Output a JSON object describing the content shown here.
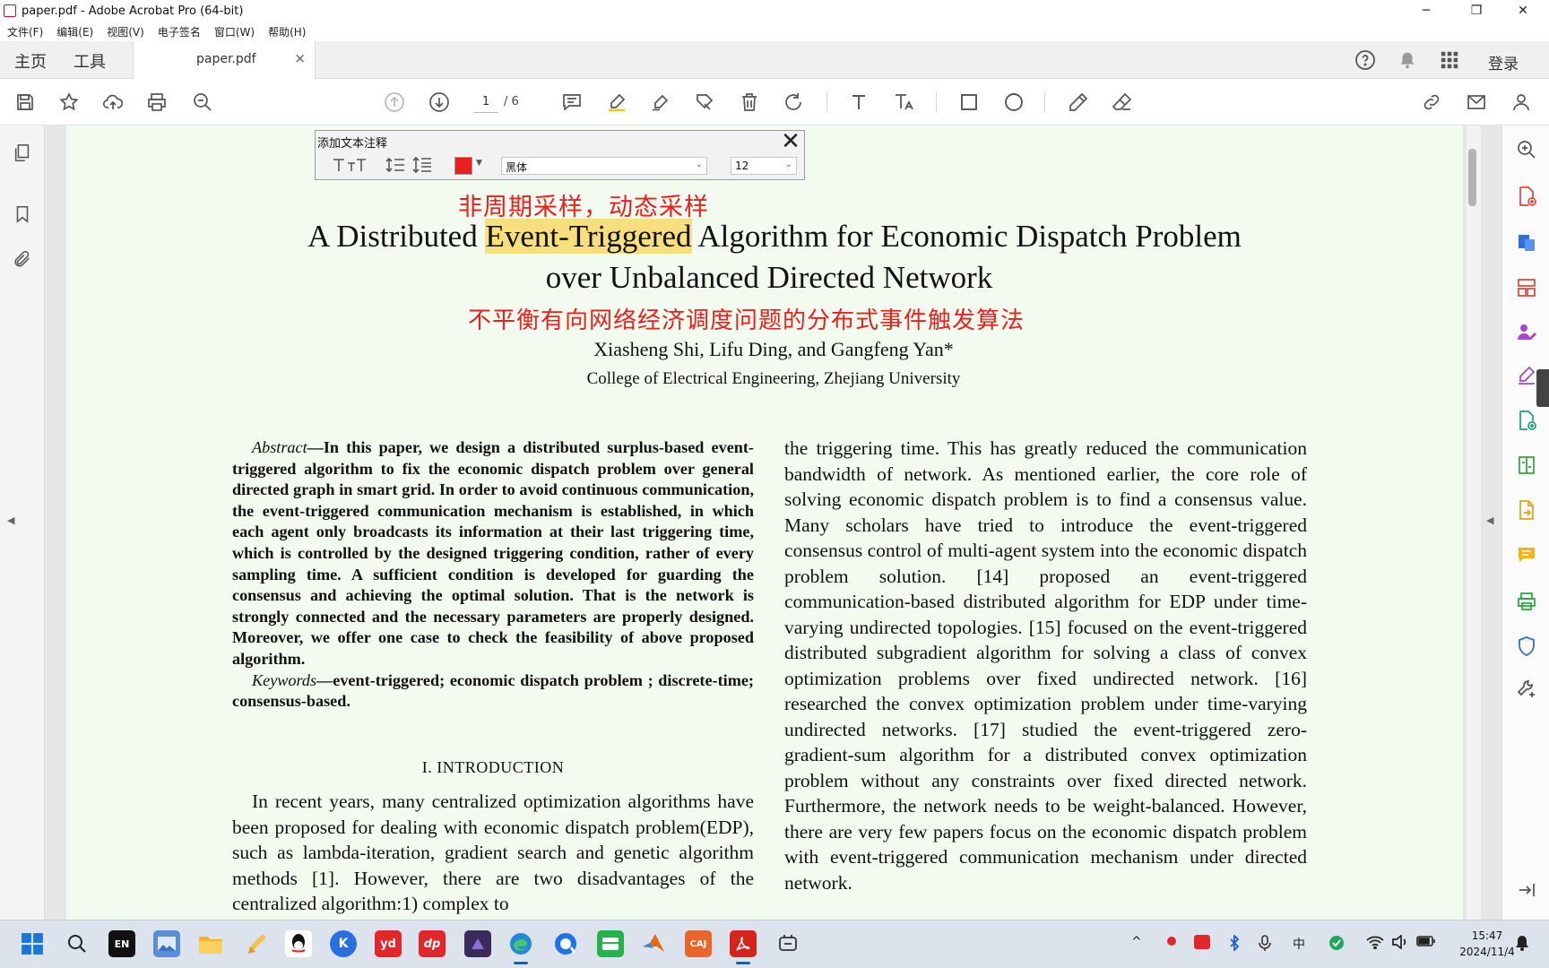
{
  "window": {
    "title": "paper.pdf - Adobe Acrobat Pro (64-bit)",
    "controls": {
      "minimize": "─",
      "restore": "❐",
      "close": "✕"
    }
  },
  "menu": [
    "文件(F)",
    "编辑(E)",
    "视图(V)",
    "电子签名",
    "窗口(W)",
    "帮助(H)"
  ],
  "tabs": {
    "home": "主页",
    "tools": "工具",
    "document": "paper.pdf",
    "close": "×",
    "login": "登录"
  },
  "toolbar": {
    "current_page": "1",
    "total_pages": "/ 6"
  },
  "annotation_toolbar": {
    "title": "添加文本注释",
    "close": "✕",
    "font": "黑体",
    "size": "12",
    "color": "#e8211c"
  },
  "paper": {
    "annotation_top": "非周期采样，动态采样",
    "title_pre": "A Distributed ",
    "title_highlight": "Event-Triggered",
    "title_post": " Algorithm for Economic Dispatch Problem",
    "title_line2": "over Unbalanced Directed Network",
    "annotation_middle": "不平衡有向网络经济调度问题的分布式事件触发算法",
    "authors": "Xiasheng Shi, Lifu Ding, and Gangfeng Yan*",
    "affiliation": "College of Electrical Engineering, Zhejiang University",
    "abstract_label": "Abstract",
    "abstract_text": "—In this paper, we design a distributed surplus-based event-triggered algorithm to fix the economic dispatch problem over general directed graph in smart grid. In order to avoid continuous communication, the event-triggered communication mechanism is established, in which each agent only broadcasts its information at their last triggering time, which is controlled by the designed triggering condition, rather of every sampling time. A sufficient condition is developed for guarding the consensus and achieving the optimal solution. That is the network is strongly connected and the necessary parameters are properly designed. Moreover, we offer one case to check the feasibility of above proposed algorithm.",
    "keywords_label": "Keywords",
    "keywords_text": "—event-triggered; economic dispatch problem ; discrete-time; consensus-based.",
    "intro_heading": "I. INTRODUCTION",
    "intro_text": "In recent years, many centralized optimization algorithms have been proposed for dealing with economic dispatch problem(EDP), such as lambda-iteration, gradient search and genetic algorithm methods [1]. However, there are two disadvantages of the centralized algorithm:1) complex to",
    "right_column": "the triggering time. This has greatly reduced the communication bandwidth of network. As mentioned earlier, the core role of solving economic dispatch problem is to find a consensus value. Many scholars have tried to introduce the event-triggered consensus control of multi-agent system into the economic dispatch problem solution. [14] proposed an event-triggered communication-based distributed algorithm for EDP under time-varying undirected topologies. [15] focused on the event-triggered distributed subgradient algorithm for solving a class of convex optimization problems over fixed undirected network. [16] researched the convex optimization problem under time-varying undirected networks. [17] studied the event-triggered zero-gradient-sum algorithm for a distributed convex optimization problem without any constraints over fixed directed network. Furthermore, the network needs to be weight-balanced. However, there are very few papers focus on the economic dispatch problem with event-triggered communication mechanism under directed network."
  },
  "taskbar": {
    "apps": [
      {
        "name": "start-icon"
      },
      {
        "name": "search-icon"
      },
      {
        "name": "en-app-icon",
        "label": "EN"
      },
      {
        "name": "photos-icon"
      },
      {
        "name": "file-explorer-icon"
      },
      {
        "name": "notepad-icon"
      },
      {
        "name": "qq-icon"
      },
      {
        "name": "k-app-icon",
        "label": "K"
      },
      {
        "name": "youdao-icon",
        "label": "yd"
      },
      {
        "name": "dp-app-icon",
        "label": "dp"
      },
      {
        "name": "game-icon"
      },
      {
        "name": "edge-icon"
      },
      {
        "name": "browser-icon"
      },
      {
        "name": "wechat-icon"
      },
      {
        "name": "matlab-icon"
      },
      {
        "name": "caj-icon",
        "label": "CAJ"
      },
      {
        "name": "acrobat-icon"
      },
      {
        "name": "snipping-icon"
      }
    ],
    "tray_lang": "中",
    "time": "15:47",
    "date": "2024/11/4"
  }
}
